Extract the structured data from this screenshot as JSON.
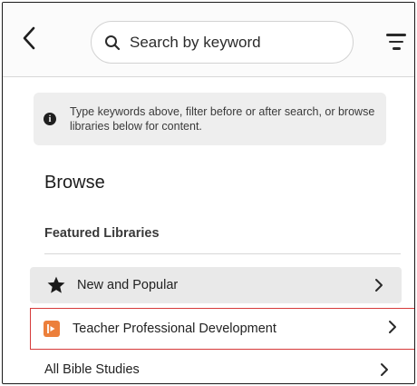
{
  "search": {
    "placeholder": "Search by keyword",
    "value": ""
  },
  "info_banner": {
    "text": "Type keywords above, filter before or after search, or browse libraries below for content."
  },
  "browse": {
    "title": "Browse",
    "section_label": "Featured Libraries"
  },
  "libraries": [
    {
      "label": "New and Popular",
      "icon": "star-icon"
    },
    {
      "label": "Teacher Professional Development",
      "icon": "library-logo-icon",
      "icon_color": "#ec7f3b",
      "highlighted": true
    },
    {
      "label": "All Bible Studies"
    }
  ],
  "colors": {
    "highlight_border": "#d63a3a",
    "selected_row": "#e9e9e9",
    "accent_caret": "#2f6fe4"
  }
}
